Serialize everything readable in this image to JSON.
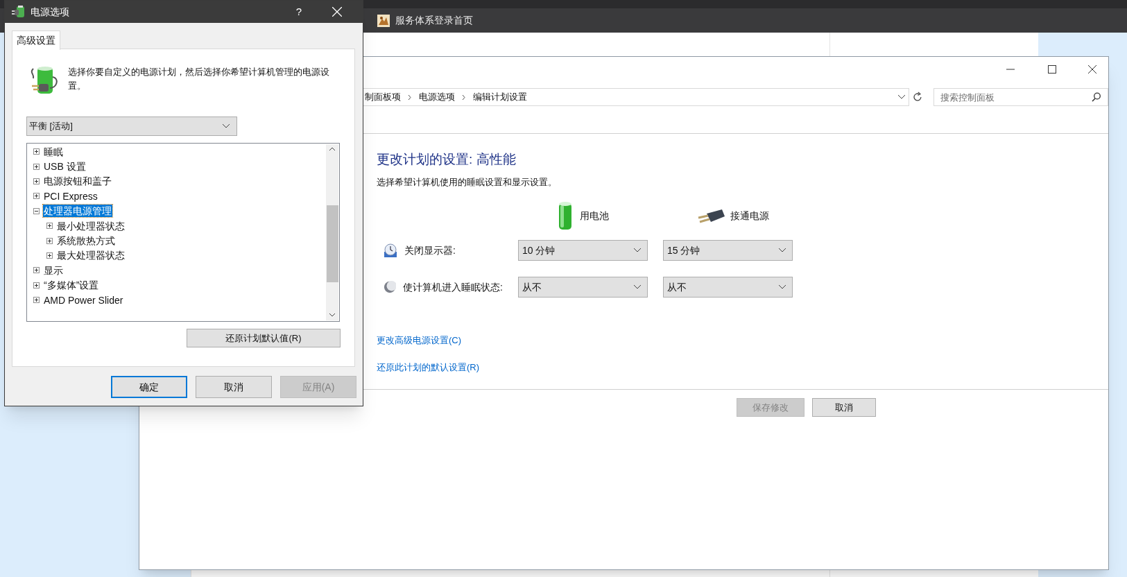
{
  "browser": {
    "bookmarks": [
      {
        "label": "服务体系登录首页"
      }
    ]
  },
  "control_panel": {
    "breadcrumb": [
      "制面板项",
      "电源选项",
      "编辑计划设置"
    ],
    "search": {
      "placeholder": "搜索控制面板"
    },
    "heading": "更改计划的设置: 高性能",
    "subtitle": "选择希望计算机使用的睡眠设置和显示设置。",
    "columns": [
      {
        "label": "用电池",
        "kind": "battery"
      },
      {
        "label": "接通电源",
        "kind": "plugged"
      }
    ],
    "settings": [
      {
        "kind": "display",
        "label": "关闭显示器:",
        "values": [
          "10 分钟",
          "15 分钟"
        ]
      },
      {
        "kind": "sleep",
        "label": "使计算机进入睡眠状态:",
        "values": [
          "从不",
          "从不"
        ]
      }
    ],
    "links": [
      "更改高级电源设置(C)",
      "还原此计划的默认设置(R)"
    ],
    "buttons": [
      {
        "label": "保存修改",
        "disabled": true
      },
      {
        "label": "取消",
        "disabled": false
      }
    ]
  },
  "dialog": {
    "title": "电源选项",
    "help": "?",
    "tabs": [
      {
        "label": "高级设置",
        "selected": true
      }
    ],
    "description": "选择你要自定义的电源计划，然后选择你希望计算机管理的电源设置。",
    "plan_select": {
      "value": "平衡 [活动]"
    },
    "tree": [
      {
        "label": "睡眠",
        "expanded": false,
        "selected": false
      },
      {
        "label": "USB 设置",
        "expanded": false,
        "selected": false
      },
      {
        "label": "电源按钮和盖子",
        "expanded": false,
        "selected": false
      },
      {
        "label": "PCI Express",
        "expanded": false,
        "selected": false
      },
      {
        "label": "处理器电源管理",
        "expanded": true,
        "selected": true,
        "children": [
          {
            "label": "最小处理器状态",
            "expanded": false,
            "selected": false
          },
          {
            "label": "系统散热方式",
            "expanded": false,
            "selected": false
          },
          {
            "label": "最大处理器状态",
            "expanded": false,
            "selected": false
          }
        ]
      },
      {
        "label": "显示",
        "expanded": false,
        "selected": false
      },
      {
        "label": "“多媒体”设置",
        "expanded": false,
        "selected": false
      },
      {
        "label": "AMD Power Slider",
        "expanded": false,
        "selected": false
      }
    ],
    "restore_button": {
      "label": "还原计划默认值(R)"
    },
    "buttons": [
      {
        "label": "确定",
        "default": true,
        "disabled": false
      },
      {
        "label": "取消",
        "default": false,
        "disabled": false
      },
      {
        "label": "应用(A)",
        "default": false,
        "disabled": true
      }
    ]
  }
}
